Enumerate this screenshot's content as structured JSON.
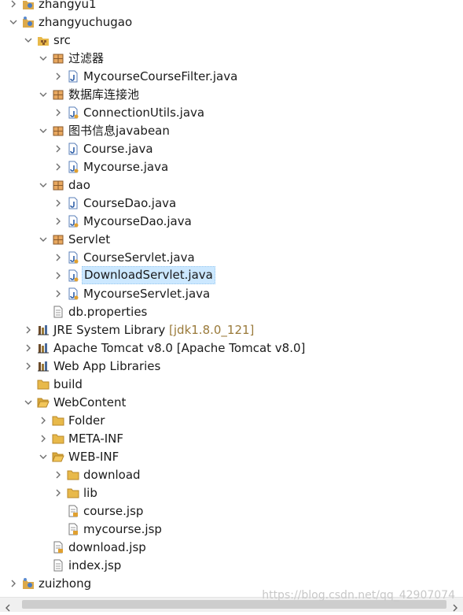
{
  "tree": [
    {
      "id": "zhangyu1",
      "label": "zhangyu1",
      "icon": "java-project-icon",
      "expand": "collapsed"
    },
    {
      "id": "zhangyuchugao",
      "label": "zhangyuchugao",
      "icon": "java-project-icon",
      "expand": "expanded"
    },
    {
      "id": "src",
      "label": "src",
      "icon": "source-folder-icon",
      "expand": "expanded"
    },
    {
      "id": "pkg-filter",
      "label": "过滤器",
      "icon": "package-icon",
      "expand": "expanded"
    },
    {
      "id": "MycourseCourseFilter",
      "label": "MycourseCourseFilter.java",
      "icon": "java-file-icon",
      "expand": "collapsed"
    },
    {
      "id": "pkg-db",
      "label": "数据库连接池",
      "icon": "package-icon",
      "expand": "expanded"
    },
    {
      "id": "ConnectionUtils",
      "label": "ConnectionUtils.java",
      "icon": "java-file-icon",
      "expand": "collapsed"
    },
    {
      "id": "pkg-bean",
      "label": "图书信息javabean",
      "icon": "package-icon",
      "expand": "expanded"
    },
    {
      "id": "Course",
      "label": "Course.java",
      "icon": "java-file-icon",
      "expand": "collapsed"
    },
    {
      "id": "Mycourse",
      "label": "Mycourse.java",
      "icon": "java-file-icon",
      "expand": "collapsed"
    },
    {
      "id": "pkg-dao",
      "label": "dao",
      "icon": "package-icon",
      "expand": "expanded"
    },
    {
      "id": "CourseDao",
      "label": "CourseDao.java",
      "icon": "java-file-icon",
      "expand": "collapsed"
    },
    {
      "id": "MycourseDao",
      "label": "MycourseDao.java",
      "icon": "java-file-icon",
      "expand": "collapsed"
    },
    {
      "id": "pkg-servlet",
      "label": "Servlet",
      "icon": "package-icon",
      "expand": "expanded"
    },
    {
      "id": "CourseServlet",
      "label": "CourseServlet.java",
      "icon": "java-file-icon",
      "expand": "collapsed"
    },
    {
      "id": "DownloadServlet",
      "label": "DownloadServlet.java",
      "icon": "java-file-icon",
      "expand": "collapsed",
      "selected": true
    },
    {
      "id": "MycourseServlet",
      "label": "MycourseServlet.java",
      "icon": "java-file-icon",
      "expand": "collapsed"
    },
    {
      "id": "db-properties",
      "label": "db.properties",
      "icon": "properties-file-icon",
      "expand": "none"
    },
    {
      "id": "jre",
      "label": "JRE System Library",
      "decoration": "[jdk1.8.0_121]",
      "icon": "library-icon",
      "expand": "collapsed"
    },
    {
      "id": "tomcat",
      "label": "Apache Tomcat v8.0 [Apache Tomcat v8.0]",
      "icon": "library-icon",
      "expand": "collapsed"
    },
    {
      "id": "webapp-libs",
      "label": "Web App Libraries",
      "icon": "library-icon",
      "expand": "collapsed"
    },
    {
      "id": "build",
      "label": "build",
      "icon": "folder-icon",
      "expand": "none"
    },
    {
      "id": "WebContent",
      "label": "WebContent",
      "icon": "folder-open-icon",
      "expand": "expanded"
    },
    {
      "id": "Folder",
      "label": "Folder",
      "icon": "folder-icon",
      "expand": "collapsed"
    },
    {
      "id": "META-INF",
      "label": "META-INF",
      "icon": "folder-icon",
      "expand": "collapsed"
    },
    {
      "id": "WEB-INF",
      "label": "WEB-INF",
      "icon": "folder-open-icon",
      "expand": "expanded"
    },
    {
      "id": "download",
      "label": "download",
      "icon": "folder-icon",
      "expand": "collapsed"
    },
    {
      "id": "lib",
      "label": "lib",
      "icon": "folder-icon",
      "expand": "collapsed"
    },
    {
      "id": "course-jsp",
      "label": "course.jsp",
      "icon": "jsp-file-icon",
      "expand": "none"
    },
    {
      "id": "mycourse-jsp",
      "label": "mycourse.jsp",
      "icon": "jsp-file-icon",
      "expand": "none"
    },
    {
      "id": "download-jsp",
      "label": "download.jsp",
      "icon": "jsp-file-icon",
      "expand": "none"
    },
    {
      "id": "index-jsp",
      "label": "index.jsp",
      "icon": "jsp-file-icon",
      "expand": "none"
    },
    {
      "id": "zuizhong",
      "label": "zuizhong",
      "icon": "java-project-icon",
      "expand": "collapsed"
    }
  ],
  "watermark": "https://blog.csdn.net/qq_42907074",
  "colors": {
    "selection": "#cce8ff",
    "decoration": "#9a7a3a",
    "folder": "#e8b94a"
  }
}
